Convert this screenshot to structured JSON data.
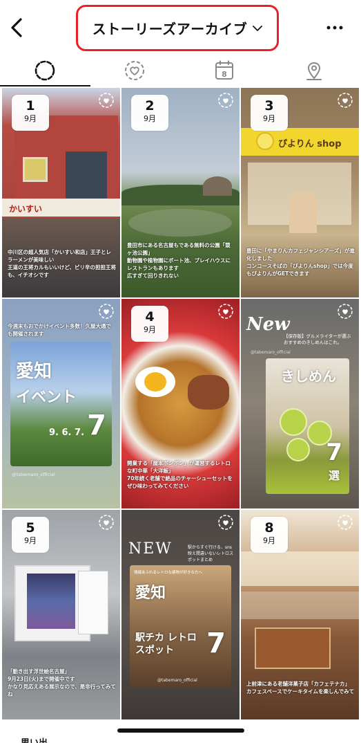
{
  "header": {
    "title": "ストーリーズアーカイブ",
    "back_icon": "chevron-left-icon",
    "more_icon": "more-dots-icon",
    "accent_color": "#e8202a"
  },
  "tabs": [
    {
      "name": "stories",
      "icon": "stories-circle-icon",
      "active": true
    },
    {
      "name": "highlights",
      "icon": "highlight-heart-icon",
      "active": false
    },
    {
      "name": "calendar",
      "icon": "calendar-icon",
      "calendar_day": "8",
      "active": false
    },
    {
      "name": "map",
      "icon": "map-pin-icon",
      "active": false
    }
  ],
  "stories": [
    {
      "day": "1",
      "month": "9月",
      "caption": "中川区の超人気店「かいすい和店」王子とレラーメンが美味しい\n王道の王将カルもいいけど、ピリ辛の担担王将も、イチオシです"
    },
    {
      "day": "2",
      "month": "9月",
      "caption": "豊田市にある名古屋もである無料の公園「競ヶ池公園」\n動物園や植物園にボート池、プレイハウスにレストランもあります\n広すぎて回りきれない"
    },
    {
      "day": "3",
      "month": "9月",
      "caption": "豊田に「やまりんカフェジャンシアーズ」が進化しました\nコンコースそばの「ぴよりんshop」では今度もぴよりんがGETできます",
      "sign_text": "ぴよりん shop"
    },
    {
      "day": "",
      "month": "",
      "caption": "今週末もおでかけイベント多数！久屋大通でも開催されます",
      "poster_title": "愛知",
      "poster_sub": "イベント",
      "poster_num": "7",
      "poster_dates": "9. 6. 7.",
      "handle": "@tabemaro_official"
    },
    {
      "day": "4",
      "month": "9月",
      "caption": "開業する「屋本ボンボン」が運営するレトロな町中華「大洋飯」\n70年続く老舗で絶品のチャーシューセットをぜひ味わってみてください"
    },
    {
      "day": "",
      "month": "",
      "caption": "",
      "new_label": "New",
      "small_header": "【保存版】グルメライターが選ぶおすすめのきしめんはこれ。",
      "poster_title": "きしめん",
      "poster_num": "7",
      "poster_sub": "選",
      "handle": "@tabemaro_official"
    },
    {
      "day": "5",
      "month": "9月",
      "caption": "「動き出す浮世絵名古屋」\n9月23日(火)まで開催中です\nかなり見応えある展示なので、是非行ってみてね"
    },
    {
      "day": "",
      "month": "",
      "caption": "",
      "new_label": "NEW",
      "small_header": "駅からすぐ行ける、sns映え間違いないレトロスポットまとめ",
      "card_header": "情緒あふれるレトロな建物が好きな方へ",
      "poster_title": "愛知",
      "poster_sub": "駅チカ レトロスポット",
      "poster_num": "7",
      "handle": "@tabemaro_official"
    },
    {
      "day": "8",
      "month": "9月",
      "caption": "上前津にある老舗洋菓子店「カフェテナカ」\nカフェスペースでケーキタイムを楽しんでみて"
    }
  ],
  "bottom": {
    "label": "思い出"
  }
}
